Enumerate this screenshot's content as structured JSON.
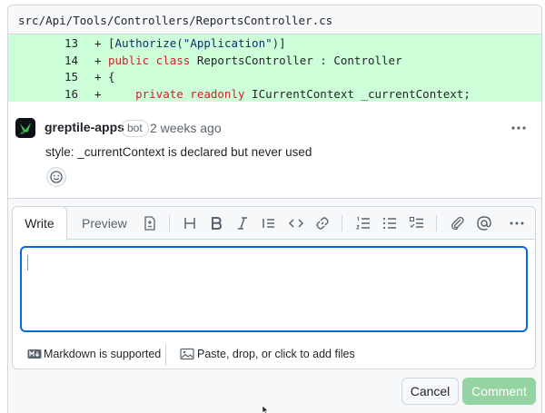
{
  "file": {
    "path": "src/Api/Tools/Controllers/ReportsController.cs"
  },
  "diff": {
    "lines": [
      {
        "num": "13",
        "marker": "+",
        "pre": "[",
        "kw1": "",
        "ident": "Authorize",
        "str": "(\"Application\")",
        "post": "]"
      },
      {
        "num": "14",
        "marker": "+",
        "kw1": "public class",
        "rest": " ReportsController : Controller"
      },
      {
        "num": "15",
        "marker": "+",
        "rest": "{"
      },
      {
        "num": "16",
        "marker": "+",
        "kw1": "    private readonly",
        "rest": " ICurrentContext _currentContext;"
      }
    ]
  },
  "comment": {
    "username": "greptile-apps",
    "badge": "bot",
    "timestamp": "2 weeks ago",
    "body": "style: _currentContext is declared but never used",
    "avatar_color": "#0d1117",
    "reaction_icon": "smiley-icon"
  },
  "reply": {
    "tabs": {
      "write": "Write",
      "preview": "Preview"
    },
    "toolbar_icons": [
      "file-diff-icon",
      "heading-icon",
      "bold-icon",
      "italic-icon",
      "quote-icon",
      "code-icon",
      "link-icon",
      "numbered-list-icon",
      "bullet-list-icon",
      "task-list-icon",
      "attach-icon",
      "mention-icon",
      "more-icon"
    ],
    "textarea_value": "",
    "markdown_label": "Markdown is supported",
    "attach_label": "Paste, drop, or click to add files",
    "cancel_label": "Cancel",
    "comment_label": "Comment"
  },
  "colors": {
    "diff_added_bg": "#ccffd8",
    "keyword": "#cf222e",
    "string": "#0a3069",
    "focus_border": "#0969da",
    "comment_button": "#94d3a2"
  }
}
